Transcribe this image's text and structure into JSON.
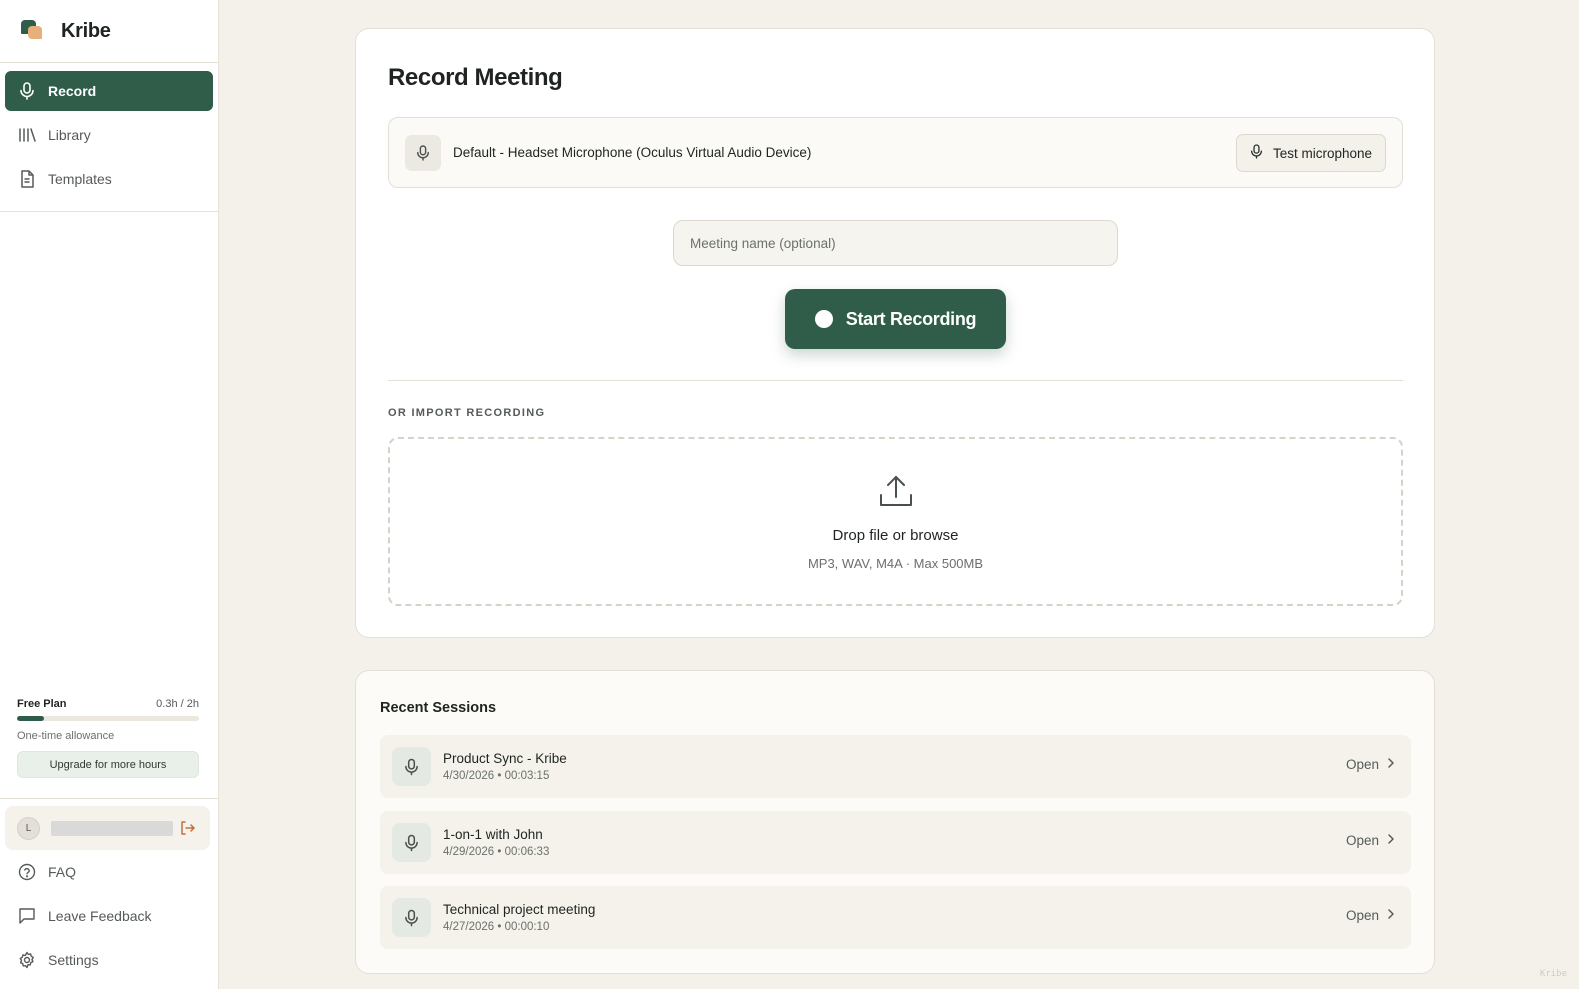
{
  "app": {
    "name": "Kribe",
    "watermark": "Kribe"
  },
  "sidebar": {
    "items": [
      {
        "label": "Record",
        "icon": "mic-icon",
        "active": true
      },
      {
        "label": "Library",
        "icon": "library-icon",
        "active": false
      },
      {
        "label": "Templates",
        "icon": "document-icon",
        "active": false
      }
    ],
    "plan": {
      "title": "Free Plan",
      "usage": "0.3h / 2h",
      "progress_fraction": 0.15,
      "note": "One-time allowance",
      "upgrade_label": "Upgrade for more hours"
    },
    "user": {
      "initial": "L"
    },
    "bottom_items": [
      {
        "label": "FAQ",
        "icon": "help-circle-icon"
      },
      {
        "label": "Leave Feedback",
        "icon": "message-square-icon"
      },
      {
        "label": "Settings",
        "icon": "gear-icon"
      }
    ]
  },
  "record": {
    "title": "Record Meeting",
    "microphone_label": "Default - Headset Microphone (Oculus Virtual Audio Device)",
    "test_label": "Test microphone",
    "meeting_placeholder": "Meeting name (optional)",
    "meeting_value": "",
    "start_label": "Start Recording",
    "import_label": "OR IMPORT RECORDING",
    "drop_title": "Drop file or browse",
    "drop_sub": "MP3, WAV, M4A · Max 500MB"
  },
  "recent": {
    "title": "Recent Sessions",
    "open_label": "Open",
    "sessions": [
      {
        "name": "Product Sync - Kribe",
        "meta": "4/30/2026 • 00:03:15"
      },
      {
        "name": "1-on-1 with John",
        "meta": "4/29/2026 • 00:06:33"
      },
      {
        "name": "Technical project meeting",
        "meta": "4/27/2026 • 00:00:10"
      }
    ]
  },
  "colors": {
    "accent": "#2f5d4a",
    "logo_secondary": "#e6b07a",
    "background": "#f4f1eb"
  }
}
